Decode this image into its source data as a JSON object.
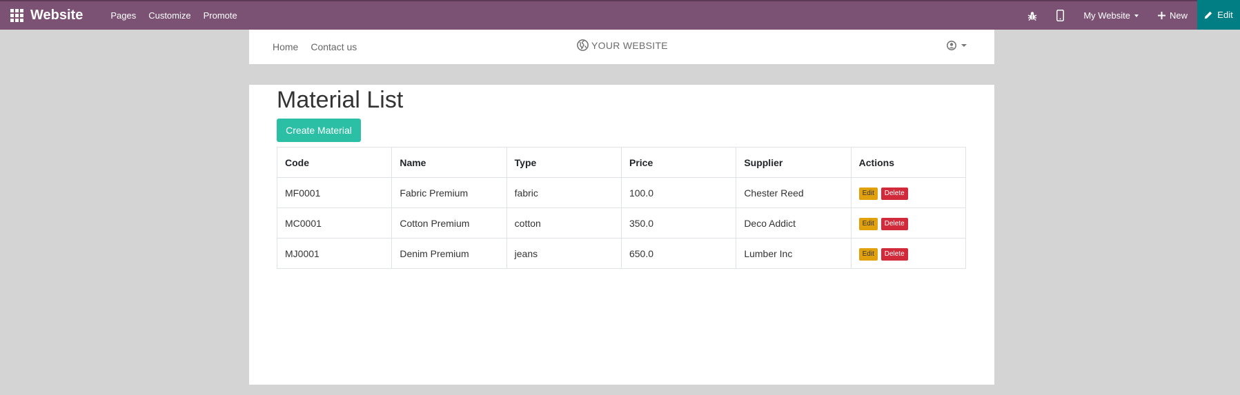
{
  "topbar": {
    "brand": "Website",
    "nav": [
      "Pages",
      "Customize",
      "Promote"
    ],
    "website_selector": "My Website",
    "new_label": "New",
    "edit_label": "Edit",
    "icons": [
      "apps-grid-icon",
      "bug-icon",
      "mobile-icon",
      "plus-icon",
      "pencil-icon"
    ],
    "colors": {
      "bar": "#7b5273",
      "edit": "#017e84"
    }
  },
  "site_header": {
    "links": [
      "Home",
      "Contact us"
    ],
    "logo_text": "YOUR WEBSITE"
  },
  "page": {
    "title": "Material List",
    "create_button": "Create Material",
    "table": {
      "headers": [
        "Code",
        "Name",
        "Type",
        "Price",
        "Supplier",
        "Actions"
      ],
      "rows": [
        {
          "code": "MF0001",
          "name": "Fabric Premium",
          "type": "fabric",
          "price": "100.0",
          "supplier": "Chester Reed"
        },
        {
          "code": "MC0001",
          "name": "Cotton Premium",
          "type": "cotton",
          "price": "350.0",
          "supplier": "Deco Addict"
        },
        {
          "code": "MJ0001",
          "name": "Denim Premium",
          "type": "jeans",
          "price": "650.0",
          "supplier": "Lumber Inc"
        }
      ],
      "edit_label": "Edit",
      "delete_label": "Delete"
    },
    "colors": {
      "create": "#2bbfa5",
      "edit_btn": "#e0a10c",
      "delete_btn": "#d12b3b"
    }
  }
}
